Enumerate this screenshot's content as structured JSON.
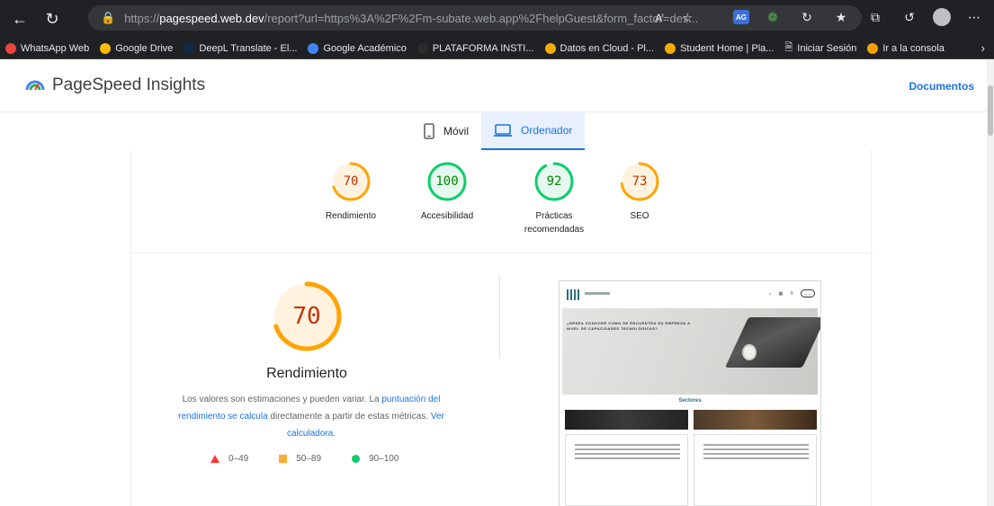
{
  "browser": {
    "url_host": "pagespeed.web.dev",
    "url_prefix": "https://",
    "url_path": "/report?url=https%3A%2F%2Fm-subate.web.app%2FhelpGuest&form_factor=des...",
    "bookmarks": [
      {
        "label": "WhatsApp Web",
        "color": "#e8453c"
      },
      {
        "label": "Google Drive",
        "color": "#fbbc04"
      },
      {
        "label": "DeepL Translate - El...",
        "color": "#0f2b46"
      },
      {
        "label": "Google Académico",
        "color": "#4285f4"
      },
      {
        "label": "PLATAFORMA INSTI...",
        "color": "#2b2b2b"
      },
      {
        "label": "Datos en Cloud - Pl...",
        "color": "#f9ab00"
      },
      {
        "label": "Student Home | Pla...",
        "color": "#f9ab00"
      },
      {
        "label": "Iniciar Sesión",
        "color": "#e8eaed"
      },
      {
        "label": "Ir a la consola",
        "color": "#ffa000"
      }
    ]
  },
  "header": {
    "title": "PageSpeed Insights",
    "docs_link": "Documentos"
  },
  "tabs": [
    {
      "label": "Móvil",
      "active": false
    },
    {
      "label": "Ordenador",
      "active": true
    }
  ],
  "scores": [
    {
      "label": "Rendimiento",
      "value": "70",
      "color": "#ffa400"
    },
    {
      "label": "Accesibilidad",
      "value": "100",
      "color": "#0cce6b"
    },
    {
      "label": "Prácticas recomendadas",
      "value": "92",
      "color": "#0cce6b"
    },
    {
      "label": "SEO",
      "value": "73",
      "color": "#ffa400"
    }
  ],
  "main_score": {
    "value": "70",
    "title": "Rendimiento",
    "desc_before": "Los valores son estimaciones y pueden variar. La ",
    "desc_link1": "puntuación del rendimiento se calcula",
    "desc_middle": " directamente a partir de estas métricas. ",
    "desc_link2": "Ver calculadora",
    "desc_after": "."
  },
  "legend": [
    {
      "label": "0–49",
      "shape": "triangle",
      "color": "#ff3333"
    },
    {
      "label": "50–89",
      "shape": "square",
      "color": "#ffaa33"
    },
    {
      "label": "90–100",
      "shape": "circle",
      "color": "#0cce6b"
    }
  ],
  "thumbnail": {
    "hero_text": "¿DESEA CONOCER COMO SE ENCUENTRA SU EMPRESA A NIVEL DE CAPACIDADES TECNOLÓGICAS?",
    "section_title": "Sectores"
  }
}
